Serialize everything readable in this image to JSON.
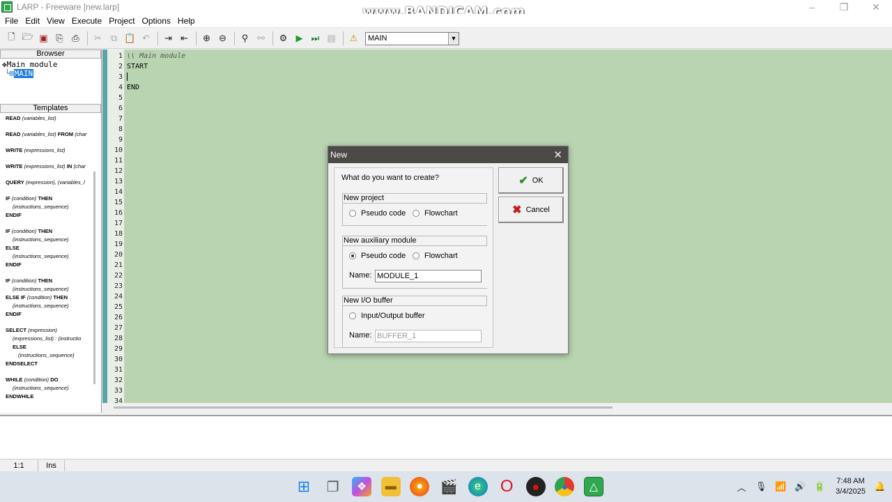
{
  "window": {
    "title": "LARP - Freeware [new.larp]",
    "watermark": "www.BANDICAM.com",
    "controls": [
      "–",
      "❐",
      "✕"
    ]
  },
  "menu": [
    "File",
    "Edit",
    "View",
    "Execute",
    "Project",
    "Options",
    "Help"
  ],
  "toolbar": {
    "buttons_group1": [
      "new-icon",
      "open-icon",
      "save-icon",
      "open-folder-icon",
      "print-icon"
    ],
    "buttons_group2": [
      "cut-icon",
      "copy-icon",
      "paste-icon",
      "undo-icon"
    ],
    "buttons_group3": [
      "indent-icon",
      "outdent-icon"
    ],
    "buttons_group4": [
      "zoom-in-icon",
      "zoom-out-icon"
    ],
    "buttons_group5": [
      "find-icon",
      "replace-icon"
    ],
    "buttons_group6": [
      "build-icon",
      "run-icon",
      "step-icon",
      "stop-icon"
    ],
    "buttons_group7": [
      "warning-icon"
    ],
    "module_select": "MAIN"
  },
  "browser": {
    "header": "Browser",
    "root": "Main module",
    "child": "MAIN"
  },
  "templates": {
    "header": "Templates"
  },
  "editor": {
    "line_count": 34,
    "lines": [
      "\\\\ Main module",
      "START",
      "",
      "END"
    ]
  },
  "status": {
    "position": "1:1",
    "mode": "Ins"
  },
  "dialog": {
    "title": "New",
    "question": "What do you want to create?",
    "new_project": {
      "header": "New project",
      "option1": "Pseudo code",
      "option2": "Flowchart",
      "selected": "none"
    },
    "new_aux": {
      "header": "New auxiliary module",
      "option1": "Pseudo code",
      "option2": "Flowchart",
      "selected": "Pseudo code",
      "name_label": "Name:",
      "name_value": "MODULE_1"
    },
    "new_io": {
      "header": "New I/O buffer",
      "option1": "Input/Output buffer",
      "name_label": "Name:",
      "name_value": "BUFFER_1"
    },
    "ok_label": "OK",
    "cancel_label": "Cancel"
  },
  "taskbar": {
    "apps": [
      "start-icon",
      "task-view-icon",
      "copilot-icon",
      "file-explorer-icon",
      "firefox-icon",
      "video-editor-icon",
      "edge-icon",
      "opera-icon",
      "record-icon",
      "chrome-icon",
      "larp-icon"
    ],
    "time": "7:48 AM",
    "date": "3/4/2025"
  },
  "colors": {
    "editor_bg": "#b8d4b0",
    "gutter_strip": "#5aa6a6",
    "dialog_title_bg": "#4c4a46",
    "ok_check": "#2a8a2a",
    "cancel_x": "#c41c1c"
  }
}
